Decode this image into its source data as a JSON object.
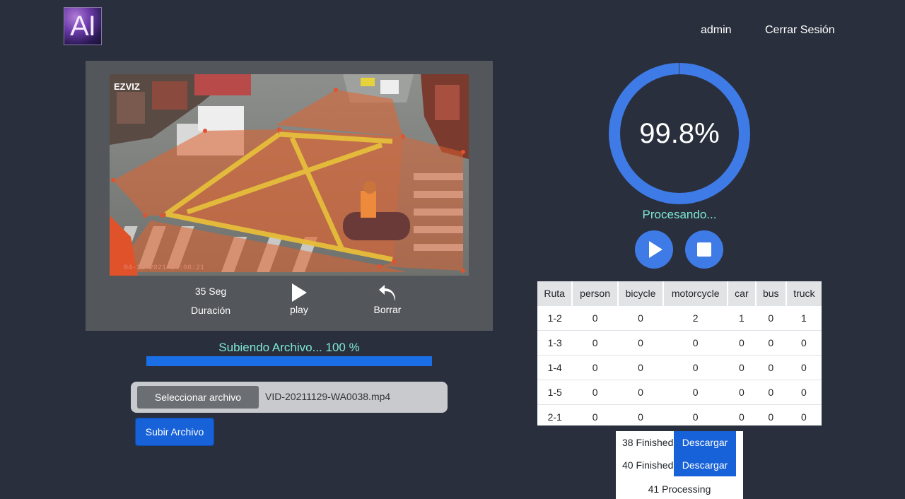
{
  "header": {
    "logo_text": "AI",
    "user_label": "admin",
    "logout_label": "Cerrar Sesión"
  },
  "video": {
    "brand_watermark": "EZVIZ",
    "timestamp_overlay": "04-11-2021 14:08:21",
    "duration_value": "35 Seg",
    "duration_label": "Duración",
    "play_label": "play",
    "delete_label": "Borrar"
  },
  "upload": {
    "status_text": "Subiendo Archivo... 100 %",
    "progress_percent": 100,
    "select_file_label": "Seleccionar archivo",
    "file_name": "VID-20211129-WA0038.mp4",
    "submit_label": "Subir Archivo"
  },
  "processing": {
    "percent_text": "99.8%",
    "progress_fraction": 0.998,
    "status_text": "Procesando...",
    "accent_color": "#3f7be6",
    "play_icon": "play-icon",
    "stop_icon": "stop-icon"
  },
  "results": {
    "headers": [
      "Ruta",
      "person",
      "bicycle",
      "motorcycle",
      "car",
      "bus",
      "truck"
    ],
    "rows": [
      [
        "1-2",
        "0",
        "0",
        "2",
        "1",
        "0",
        "1"
      ],
      [
        "1-3",
        "0",
        "0",
        "0",
        "0",
        "0",
        "0"
      ],
      [
        "1-4",
        "0",
        "0",
        "0",
        "0",
        "0",
        "0"
      ],
      [
        "1-5",
        "0",
        "0",
        "0",
        "0",
        "0",
        "0"
      ],
      [
        "2-1",
        "0",
        "0",
        "0",
        "0",
        "0",
        "0"
      ]
    ]
  },
  "jobs": [
    {
      "label": "38 Finished",
      "action": "Descargar"
    },
    {
      "label": "40 Finished",
      "action": "Descargar"
    },
    {
      "label": "41 Processing"
    }
  ]
}
